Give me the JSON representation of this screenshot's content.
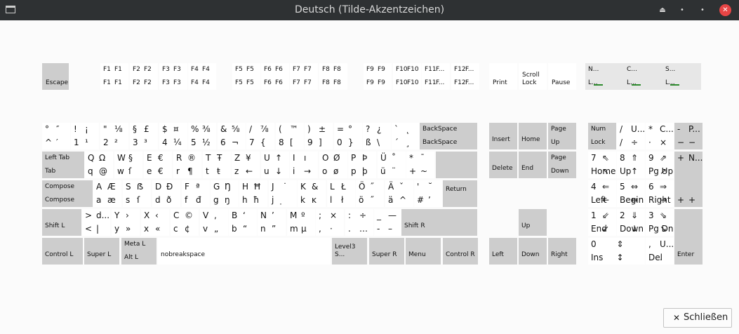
{
  "window": {
    "title": "Deutsch (Tilde-Akzentzeichen)",
    "shade_glyph": "⏏",
    "minimize_glyph": "•",
    "maximize_glyph": "•",
    "close_glyph": "✕"
  },
  "close_button": {
    "icon": "✕",
    "label": "Schließen"
  },
  "colors": {
    "led": "#2e8b2e",
    "key_gray": "#cdcdcd",
    "key_white": "#ffffff"
  },
  "keys": [
    {
      "id": "escape",
      "name": "Escape",
      "t": "escape"
    },
    {
      "id": "f1",
      "tl": "F1",
      "tr": "F1",
      "bl": "F1",
      "br": "F1"
    },
    {
      "id": "f2",
      "tl": "F2",
      "tr": "F2",
      "bl": "F2",
      "br": "F2"
    },
    {
      "id": "f3",
      "tl": "F3",
      "tr": "F3",
      "bl": "F3",
      "br": "F3"
    },
    {
      "id": "f4",
      "tl": "F4",
      "tr": "F4",
      "bl": "F4",
      "br": "F4"
    },
    {
      "id": "f5",
      "tl": "F5",
      "tr": "F5",
      "bl": "F5",
      "br": "F5"
    },
    {
      "id": "f6",
      "tl": "F6",
      "tr": "F6",
      "bl": "F6",
      "br": "F6"
    },
    {
      "id": "f7",
      "tl": "F7",
      "tr": "F7",
      "bl": "F7",
      "br": "F7"
    },
    {
      "id": "f8",
      "tl": "F8",
      "tr": "F8",
      "bl": "F8",
      "br": "F8"
    },
    {
      "id": "f9",
      "tl": "F9",
      "tr": "F9",
      "bl": "F9",
      "br": "F9"
    },
    {
      "id": "f10",
      "tl": "F10",
      "tr": "F10",
      "bl": "F10",
      "br": "F10"
    },
    {
      "id": "f11",
      "tl": "F11",
      "tr": "F...",
      "bl": "F11",
      "br": "F..."
    },
    {
      "id": "f12",
      "tl": "F12",
      "tr": "F...",
      "bl": "F12",
      "br": "F..."
    },
    {
      "id": "print",
      "name": "Print"
    },
    {
      "id": "scroll-lock",
      "name": "Scroll\nLock"
    },
    {
      "id": "pause",
      "name": "Pause"
    },
    {
      "id": "led-num",
      "tl": "N...",
      "bl": "L..."
    },
    {
      "id": "led-caps",
      "tl": "C...",
      "bl": "L..."
    },
    {
      "id": "led-scroll",
      "tl": "S...",
      "bl": "L..."
    },
    {
      "id": "grave",
      "tl": "°",
      "tr": "″",
      "bl": "^",
      "br": "′"
    },
    {
      "id": "k1",
      "tl": "!",
      "tr": "¡",
      "bl": "1",
      "br": "¹"
    },
    {
      "id": "k2",
      "tl": "\"",
      "tr": "⅛",
      "bl": "2",
      "br": "²"
    },
    {
      "id": "k3",
      "tl": "§",
      "tr": "£",
      "bl": "3",
      "br": "³"
    },
    {
      "id": "k4",
      "tl": "$",
      "tr": "¤",
      "bl": "4",
      "br": "¼"
    },
    {
      "id": "k5",
      "tl": "%",
      "tr": "⅜",
      "bl": "5",
      "br": "½"
    },
    {
      "id": "k6",
      "tl": "&",
      "tr": "⅝",
      "bl": "6",
      "br": "¬"
    },
    {
      "id": "k7",
      "tl": "/",
      "tr": "⅞",
      "bl": "7",
      "br": "{"
    },
    {
      "id": "k8",
      "tl": "(",
      "tr": "™",
      "bl": "8",
      "br": "["
    },
    {
      "id": "k9",
      "tl": ")",
      "tr": "±",
      "bl": "9",
      "br": "]"
    },
    {
      "id": "k0",
      "tl": "=",
      "tr": "°",
      "bl": "0",
      "br": "}"
    },
    {
      "id": "sz",
      "tl": "?",
      "tr": "¿",
      "bl": "ß",
      "br": "\\"
    },
    {
      "id": "acute",
      "tl": "`",
      "tr": "˛",
      "bl": "´",
      "br": "¸"
    },
    {
      "id": "backspace",
      "tl": "BackSpace",
      "bl": "BackSpace"
    },
    {
      "id": "tab",
      "tl": "Left Tab",
      "bl": "Tab"
    },
    {
      "id": "q",
      "tl": "Q",
      "tr": "Ω",
      "bl": "q",
      "br": "@"
    },
    {
      "id": "w",
      "tl": "W",
      "tr": "§",
      "bl": "w",
      "br": "ſ"
    },
    {
      "id": "e",
      "tl": "E",
      "tr": "€",
      "bl": "e",
      "br": "€"
    },
    {
      "id": "r",
      "tl": "R",
      "tr": "®",
      "bl": "r",
      "br": "¶"
    },
    {
      "id": "t",
      "tl": "T",
      "tr": "Ŧ",
      "bl": "t",
      "br": "ŧ"
    },
    {
      "id": "z",
      "tl": "Z",
      "tr": "¥",
      "bl": "z",
      "br": "←"
    },
    {
      "id": "u",
      "tl": "U",
      "tr": "↑",
      "bl": "u",
      "br": "↓"
    },
    {
      "id": "i",
      "tl": "I",
      "tr": "ı",
      "bl": "i",
      "br": "→"
    },
    {
      "id": "o",
      "tl": "O",
      "tr": "Ø",
      "bl": "o",
      "br": "ø"
    },
    {
      "id": "p",
      "tl": "P",
      "tr": "Þ",
      "bl": "p",
      "br": "þ"
    },
    {
      "id": "ue",
      "tl": "Ü",
      "tr": "˚",
      "bl": "ü",
      "br": "¨"
    },
    {
      "id": "plus",
      "tl": "*",
      "tr": "¯",
      "bl": "+",
      "br": "~"
    },
    {
      "id": "caps",
      "tl": "Compose",
      "bl": "Compose"
    },
    {
      "id": "a",
      "tl": "A",
      "tr": "Æ",
      "bl": "a",
      "br": "æ"
    },
    {
      "id": "s",
      "tl": "S",
      "tr": "ẞ",
      "bl": "s",
      "br": "ſ"
    },
    {
      "id": "d",
      "tl": "D",
      "tr": "Ð",
      "bl": "d",
      "br": "ð"
    },
    {
      "id": "f",
      "tl": "F",
      "tr": "ª",
      "bl": "f",
      "br": "đ"
    },
    {
      "id": "g",
      "tl": "G",
      "tr": "Ŋ",
      "bl": "g",
      "br": "ŋ"
    },
    {
      "id": "h",
      "tl": "H",
      "tr": "Ħ",
      "bl": "h",
      "br": "ħ"
    },
    {
      "id": "j",
      "tl": "J",
      "tr": "˙",
      "bl": "j",
      "br": "̣"
    },
    {
      "id": "k",
      "tl": "K",
      "tr": "&",
      "bl": "k",
      "br": "ĸ"
    },
    {
      "id": "l",
      "tl": "L",
      "tr": "Ł",
      "bl": "l",
      "br": "ł"
    },
    {
      "id": "oe",
      "tl": "Ö",
      "tr": "˝",
      "bl": "ö",
      "br": "˝"
    },
    {
      "id": "ae",
      "tl": "Ä",
      "tr": "ˇ",
      "bl": "ä",
      "br": "^"
    },
    {
      "id": "hash",
      "tl": "'",
      "tr": "˘",
      "bl": "#",
      "br": "’"
    },
    {
      "id": "return",
      "tl": "Return"
    },
    {
      "id": "shift-l",
      "tl": "Shift L"
    },
    {
      "id": "less",
      "tl": ">",
      "tr": "d...",
      "bl": "<",
      "br": "|"
    },
    {
      "id": "y",
      "tl": "Y",
      "tr": "›",
      "bl": "y",
      "br": "»"
    },
    {
      "id": "x",
      "tl": "X",
      "tr": "‹",
      "bl": "x",
      "br": "«"
    },
    {
      "id": "c",
      "tl": "C",
      "tr": "©",
      "bl": "c",
      "br": "¢"
    },
    {
      "id": "v",
      "tl": "V",
      "tr": ",",
      "bl": "v",
      "br": "„"
    },
    {
      "id": "b",
      "tl": "B",
      "tr": "‘",
      "bl": "b",
      "br": "“"
    },
    {
      "id": "n",
      "tl": "N",
      "tr": "’",
      "bl": "n",
      "br": "”"
    },
    {
      "id": "m",
      "tl": "M",
      "tr": "º",
      "bl": "m",
      "br": "µ"
    },
    {
      "id": "comma",
      "tl": ";",
      "tr": "×",
      "bl": ",",
      "br": "·"
    },
    {
      "id": "period",
      "tl": ":",
      "tr": "÷",
      "bl": ".",
      "br": "…"
    },
    {
      "id": "minus",
      "tl": "_",
      "tr": "—",
      "bl": "-",
      "br": "–"
    },
    {
      "id": "shift-r",
      "tl": "Shift R"
    },
    {
      "id": "ctrl-l",
      "tl": "Control L"
    },
    {
      "id": "super-l",
      "tl": "Super L"
    },
    {
      "id": "alt-l",
      "tl": "Meta L",
      "bl": "Alt L"
    },
    {
      "id": "space",
      "tl": "nobreakspace"
    },
    {
      "id": "altgr",
      "tl": "Level3 S..."
    },
    {
      "id": "super-r",
      "tl": "Super R"
    },
    {
      "id": "menu",
      "tl": "Menu"
    },
    {
      "id": "ctrl-r",
      "tl": "Control R"
    },
    {
      "id": "insert",
      "tl": "Insert"
    },
    {
      "id": "home",
      "tl": "Home"
    },
    {
      "id": "pgup",
      "tl": "Page",
      "bl": "Up"
    },
    {
      "id": "delete",
      "tl": "Delete"
    },
    {
      "id": "end",
      "tl": "End"
    },
    {
      "id": "pgdn",
      "tl": "Page",
      "bl": "Down"
    },
    {
      "id": "up",
      "tl": "Up"
    },
    {
      "id": "left",
      "tl": "Left"
    },
    {
      "id": "down",
      "tl": "Down"
    },
    {
      "id": "right",
      "tl": "Right"
    },
    {
      "id": "numlock",
      "tl": "Num",
      "bl": "Lock"
    },
    {
      "id": "kp-div",
      "tl": "/",
      "tr": "U...",
      "bl": "/",
      "br": "÷"
    },
    {
      "id": "kp-mul",
      "tl": "*",
      "tr": "C...",
      "bl": "·",
      "br": "×"
    },
    {
      "id": "kp-sub",
      "tl": "-",
      "tr": "P...",
      "bl": "−",
      "br": "−"
    },
    {
      "id": "kp7",
      "tl": "7",
      "tr": "⇖",
      "bl": "Home",
      "br": "↖"
    },
    {
      "id": "kp8",
      "tl": "8",
      "tr": "⇑",
      "bl": "Up",
      "br": "↑"
    },
    {
      "id": "kp9",
      "tl": "9",
      "tr": "⇗",
      "bl": "Pg Up",
      "br": "↗"
    },
    {
      "id": "kp-add",
      "tl": "+",
      "tr": "N...",
      "bl": "+",
      "br": "+"
    },
    {
      "id": "kp4",
      "tl": "4",
      "tr": "⇐",
      "bl": "Left",
      "br": "←"
    },
    {
      "id": "kp5",
      "tl": "5",
      "tr": "⇔",
      "bl": "Begin",
      "br": "↔"
    },
    {
      "id": "kp6",
      "tl": "6",
      "tr": "⇒",
      "bl": "Right",
      "br": "→"
    },
    {
      "id": "kp1",
      "tl": "1",
      "tr": "⇙",
      "bl": "End",
      "br": "↙"
    },
    {
      "id": "kp2",
      "tl": "2",
      "tr": "⇓",
      "bl": "Down",
      "br": "↓"
    },
    {
      "id": "kp3",
      "tl": "3",
      "tr": "⇘",
      "bl": "Pg Dn",
      "br": "↘"
    },
    {
      "id": "kp-enter",
      "tl": "Enter"
    },
    {
      "id": "kp0",
      "tl": "0",
      "tr": "⇕",
      "bl": "Ins",
      "br": "↕"
    },
    {
      "id": "kp-dec",
      "tl": ",",
      "tr": "U...",
      "bl": "Del",
      "br": "."
    }
  ]
}
